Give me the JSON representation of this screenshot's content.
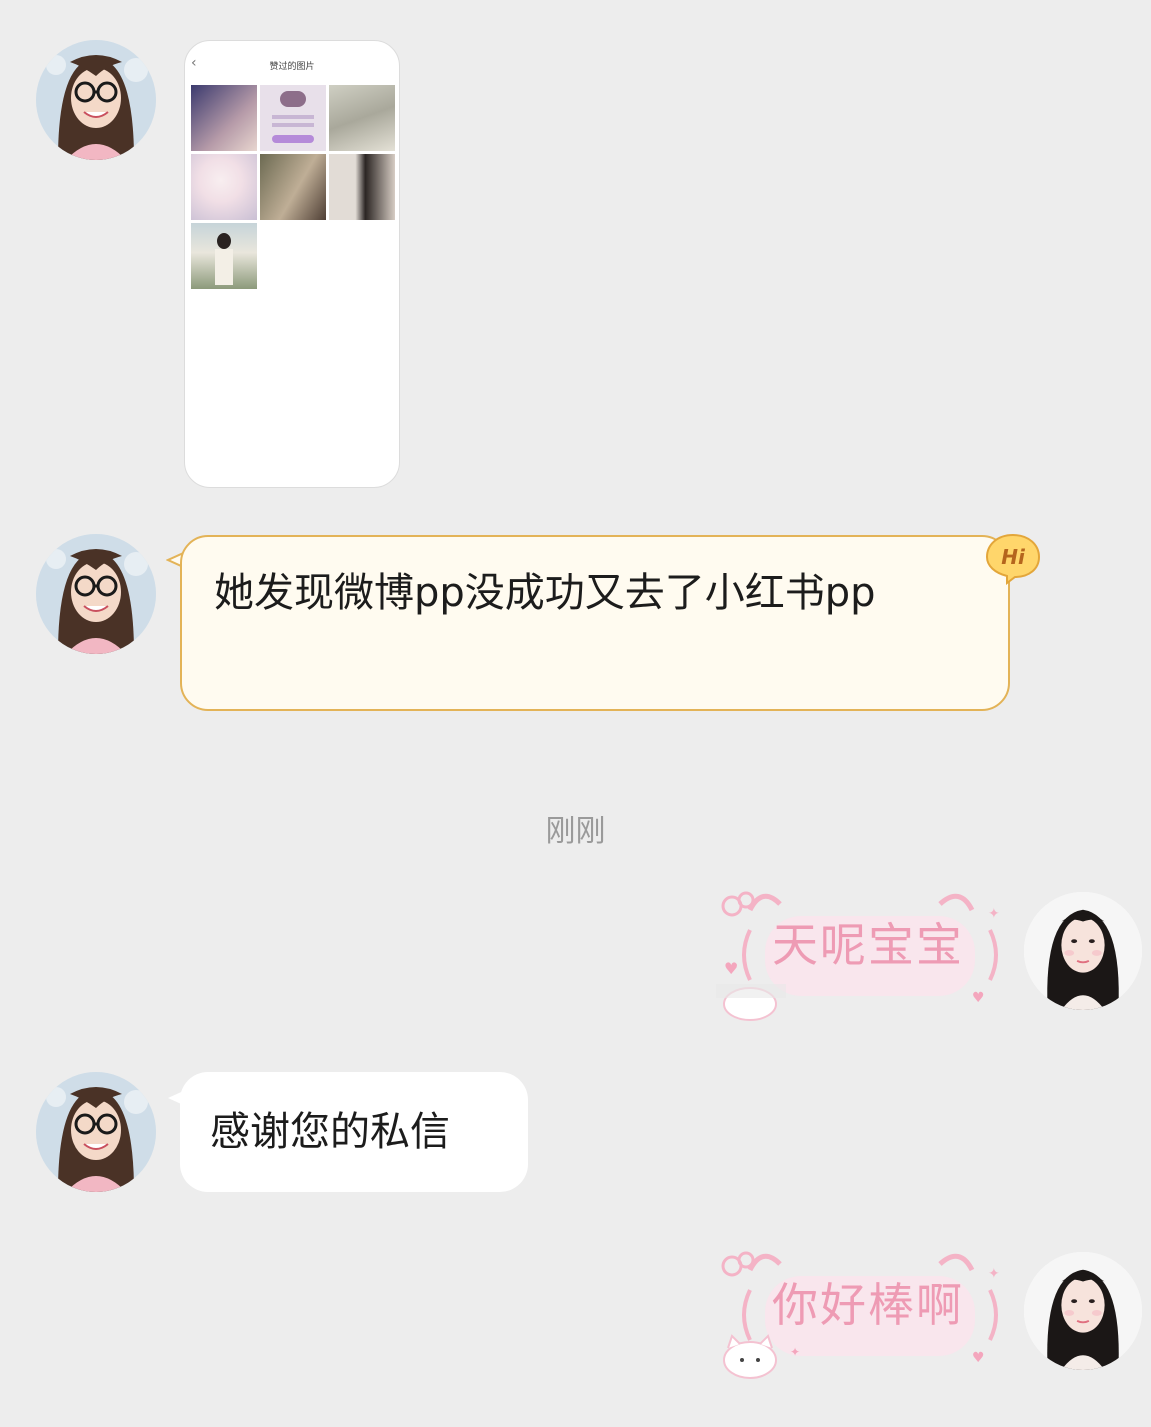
{
  "screenshot_card": {
    "title": "赞过的图片"
  },
  "messages": [
    {
      "sender": "them",
      "kind": "image"
    },
    {
      "sender": "them",
      "kind": "text",
      "text": "她发现微博pp没成功又去了小红书pp",
      "badge": "Hi"
    },
    {
      "sender": "me",
      "kind": "sticker-text",
      "text": "天呢宝宝"
    },
    {
      "sender": "them",
      "kind": "text",
      "text": "感谢您的私信"
    },
    {
      "sender": "me",
      "kind": "sticker-text",
      "text": "你好棒啊"
    }
  ],
  "timestamp": "刚刚",
  "colors": {
    "background": "#ededed",
    "gold_bubble": "#fffbf0",
    "gold_border": "#e3b357",
    "pink_text": "#ee9bb4"
  }
}
